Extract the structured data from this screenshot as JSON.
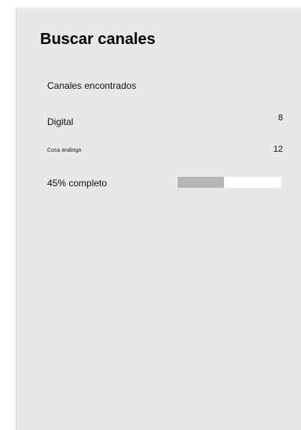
{
  "title": "Buscar canales",
  "section_label": "Canales encontrados",
  "channels": [
    {
      "label": "Digital",
      "count": "8"
    },
    {
      "label": "Cosa análoga",
      "count": "12"
    }
  ],
  "progress": {
    "label": "45% completo",
    "percent": 45
  },
  "colors": {
    "panel_bg": "#e8e8e8",
    "progress_fill": "#b4b4b4",
    "progress_track": "#ffffff"
  }
}
